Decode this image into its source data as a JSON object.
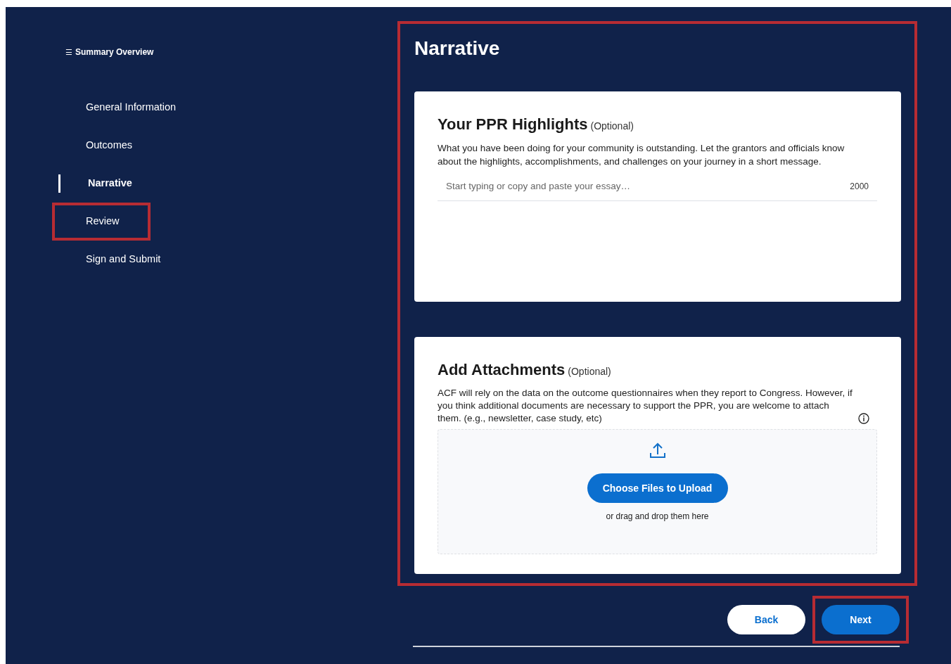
{
  "sidebar": {
    "menu_glyph": "☰",
    "title": "Summary Overview",
    "items": [
      {
        "label": "General Information",
        "selected": false,
        "highlighted": false
      },
      {
        "label": "Outcomes",
        "selected": false,
        "highlighted": false
      },
      {
        "label": "Narrative",
        "selected": true,
        "highlighted": false
      },
      {
        "label": "Review",
        "selected": false,
        "highlighted": true
      },
      {
        "label": "Sign and Submit",
        "selected": false,
        "highlighted": false
      }
    ]
  },
  "main": {
    "title": "Narrative",
    "highlighted": true,
    "highlights_card": {
      "heading": "Your PPR Highlights",
      "optional": "(Optional)",
      "description": "What you have been doing for your community is outstanding. Let the grantors and officials know about the highlights, accomplishments, and challenges on your journey in a short message.",
      "placeholder": "Start typing or copy and paste your essay…",
      "char_limit": "2000"
    },
    "attachments_card": {
      "heading": "Add Attachments",
      "optional": "(Optional)",
      "description": "ACF will rely on the data on the outcome questionnaires when they report to Congress. However, if you think additional documents are necessary to support the PPR, you are welcome to attach them. (e.g., newsletter, case study, etc)",
      "upload_button": "Choose Files to Upload",
      "drop_hint": "or drag and drop them here"
    }
  },
  "buttons": [
    {
      "kind": "secondary",
      "label": "Back",
      "highlighted": false
    },
    {
      "kind": "primary",
      "label": "Next",
      "highlighted": true
    }
  ]
}
